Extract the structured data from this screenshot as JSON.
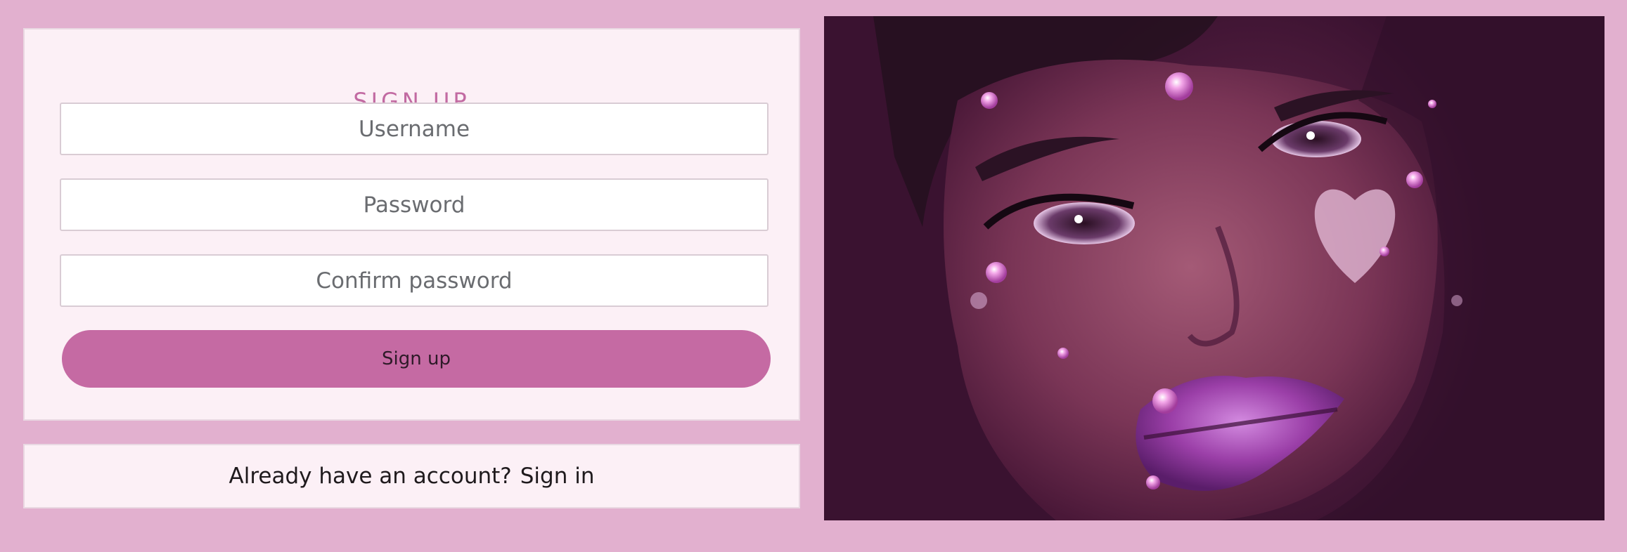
{
  "signup": {
    "title": "SIGN UP",
    "username_placeholder": "Username",
    "password_placeholder": "Password",
    "confirm_placeholder": "Confirm password",
    "submit_label": "Sign up"
  },
  "signin": {
    "prompt": "Already have an account?",
    "link_label": "Sign in"
  },
  "hero_image": {
    "alt": "Close-up portrait with pink gems and glitter lips"
  },
  "colors": {
    "page_background": "#e2b0cf",
    "card_background": "#fcf0f6",
    "accent": "#c56aa3",
    "title_color": "#c26aa2"
  }
}
